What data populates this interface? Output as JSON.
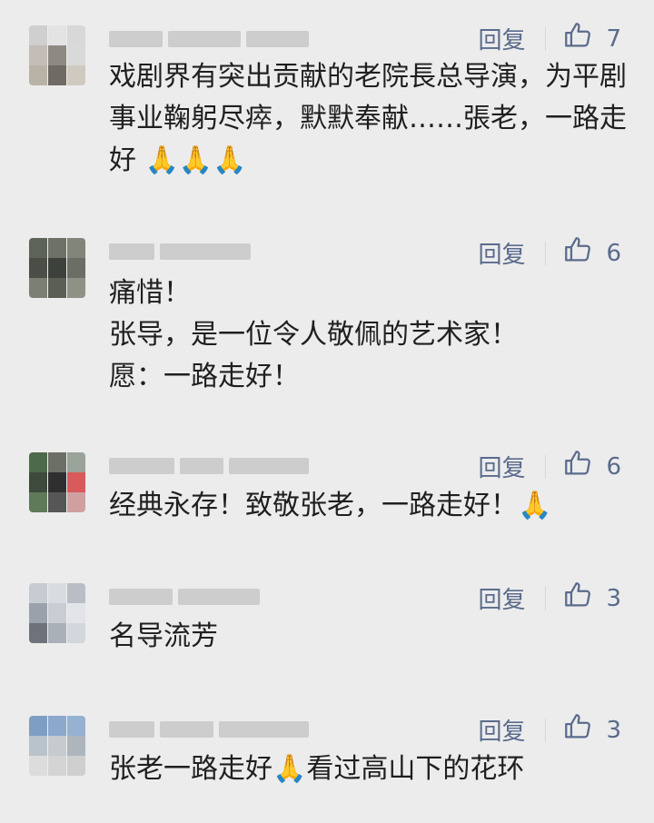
{
  "comments": [
    {
      "reply_label": "回复",
      "likes": "7",
      "lines": [
        "戏剧界有突出贡献的老院長总导演，为平剧事业鞠躬尽瘁，默默奉献……張老，一路走好 🙏🙏🙏"
      ],
      "avatar_colors": [
        "#cfcfcf",
        "#e3e3e3",
        "#d8d8d8",
        "#c2bdb6",
        "#8e8a83",
        "#d9d9d9",
        "#b9b2a7",
        "#6f6b64",
        "#cfc9c0"
      ]
    },
    {
      "reply_label": "回复",
      "likes": "6",
      "lines": [
        "痛惜！",
        "张导，是一位令人敬佩的艺术家！",
        "愿：一路走好！"
      ],
      "avatar_colors": [
        "#5e6359",
        "#6d7167",
        "#81857a",
        "#4a4e46",
        "#3d413b",
        "#6a6e64",
        "#7b7f74",
        "#5a5e55",
        "#8e9186"
      ]
    },
    {
      "reply_label": "回复",
      "likes": "6",
      "lines": [
        "经典永存！致敬张老，一路走好！🙏"
      ],
      "avatar_colors": [
        "#4d6a4a",
        "#6b6f66",
        "#9aa39a",
        "#3e4a3c",
        "#2f2f2f",
        "#d85a5a",
        "#5e7a58",
        "#565656",
        "#d0a0a0"
      ]
    },
    {
      "reply_label": "回复",
      "likes": "3",
      "lines": [
        "名导流芳"
      ],
      "avatar_colors": [
        "#c7cbd2",
        "#d8dbe0",
        "#b9bec6",
        "#9ba1aa",
        "#c9ccd2",
        "#e2e4e8",
        "#6e737b",
        "#aab0b8",
        "#d3d6db"
      ]
    },
    {
      "reply_label": "回复",
      "likes": "3",
      "lines": [
        "张老一路走好🙏看过高山下的花环"
      ],
      "avatar_colors": [
        "#7f9ec3",
        "#8aa9cc",
        "#95b2d2",
        "#b9c3cc",
        "#c7cbd0",
        "#aeb6bd",
        "#dcdcdc",
        "#d4d4d4",
        "#cfcfcf"
      ]
    }
  ]
}
